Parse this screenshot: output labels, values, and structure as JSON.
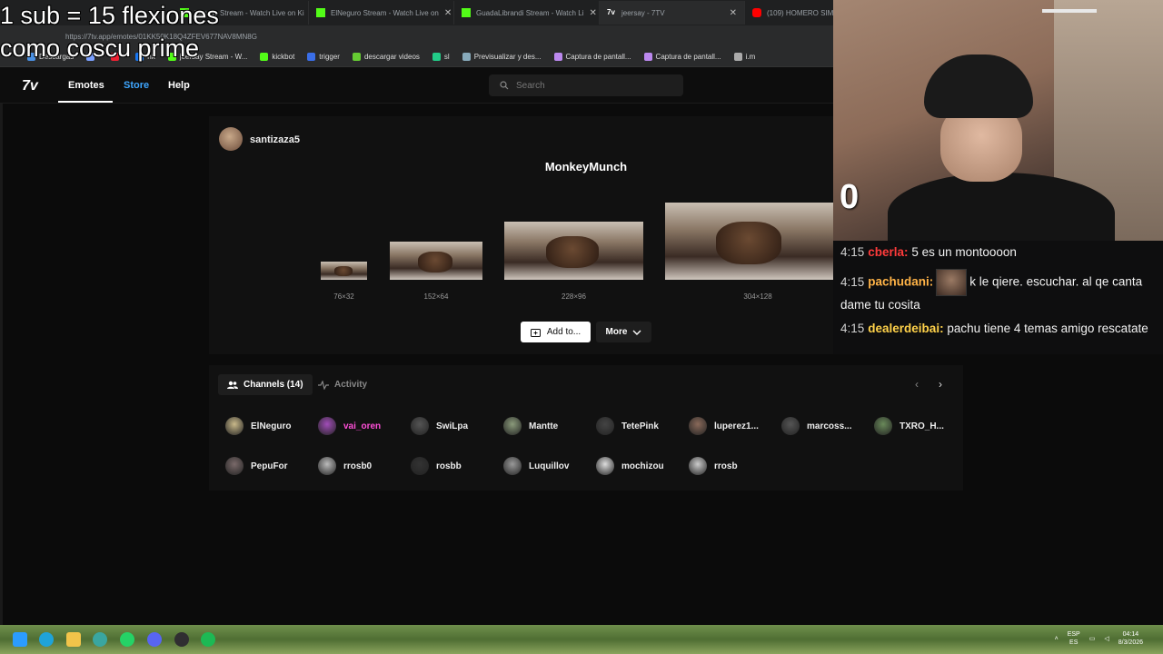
{
  "overlay": {
    "line1": "1 sub = 15 flexiones",
    "line2": "como coscu prime"
  },
  "browser": {
    "tabs": [
      {
        "title": "jeersay Stream - Watch Live on Ki",
        "icon_color": "#53fc18",
        "active": false
      },
      {
        "title": "ElNeguro Stream - Watch Live on",
        "icon_color": "#53fc18",
        "active": false
      },
      {
        "title": "GuadaLibrandi Stream - Watch Li",
        "icon_color": "#53fc18",
        "active": false
      },
      {
        "title": "jeersay - 7TV",
        "icon_color": "#ffffff",
        "active": true
      },
      {
        "title": "(109) HOMERO SIM",
        "icon_color": "#ff0000",
        "active": false
      }
    ],
    "url": "https://7tv.app/emotes/01KK50K18Q4ZFEV677NAV8MN8G",
    "bookmarks": [
      {
        "label": "Descargas",
        "color": "#4a90e2"
      },
      {
        "label": "",
        "color": "#7aa0ff"
      },
      {
        "label": "",
        "color": "#e23"
      },
      {
        "label": "nk",
        "color": "#1877f2"
      },
      {
        "label": "jeersay Stream - W...",
        "color": "#53fc18"
      },
      {
        "label": "kickbot",
        "color": "#53fc18"
      },
      {
        "label": "trigger",
        "color": "#3a6ee8"
      },
      {
        "label": "descargar videos",
        "color": "#6c3"
      },
      {
        "label": "sl",
        "color": "#2c8"
      },
      {
        "label": "Previsualizar y des...",
        "color": "#8ab"
      },
      {
        "label": "Captura de pantall...",
        "color": "#b8e"
      },
      {
        "label": "Captura de pantall...",
        "color": "#b8e"
      },
      {
        "label": "i.m",
        "color": "#aaa"
      }
    ]
  },
  "site": {
    "logo": "7v",
    "nav": {
      "emotes": "Emotes",
      "store": "Store",
      "help": "Help"
    },
    "search_placeholder": "Search"
  },
  "emote": {
    "owner": "santizaza5",
    "name": "MonkeyMunch",
    "sizes": [
      "76×32",
      "152×64",
      "228×96",
      "304×128"
    ],
    "add_label": "Add to...",
    "more_label": "More"
  },
  "channels": {
    "tab_channels": "Channels (14)",
    "tab_activity": "Activity",
    "list": [
      {
        "name": "ElNeguro",
        "color": "#c9b98a",
        "text_color": "#eeeeee"
      },
      {
        "name": "vai_oren",
        "color": "#a14db8",
        "text_color": "#ff4fd8"
      },
      {
        "name": "SwiLpa",
        "color": "#555555",
        "text_color": "#eeeeee"
      },
      {
        "name": "Mantte",
        "color": "#8b9b7b",
        "text_color": "#eeeeee"
      },
      {
        "name": "TetePink",
        "color": "#444444",
        "text_color": "#eeeeee"
      },
      {
        "name": "luperez1...",
        "color": "#8a6a5a",
        "text_color": "#eeeeee"
      },
      {
        "name": "marcoss...",
        "color": "#555555",
        "text_color": "#eeeeee"
      },
      {
        "name": "TXRO_H...",
        "color": "#6a8a5a",
        "text_color": "#eeeeee"
      },
      {
        "name": "PepuFor",
        "color": "#7a6a6a",
        "text_color": "#eeeeee"
      },
      {
        "name": "rrosb0",
        "color": "#bbbbbb",
        "text_color": "#eeeeee"
      },
      {
        "name": "rosbb",
        "color": "#333333",
        "text_color": "#eeeeee"
      },
      {
        "name": "Luquillov",
        "color": "#999999",
        "text_color": "#eeeeee"
      },
      {
        "name": "mochizou",
        "color": "#dddddd",
        "text_color": "#eeeeee"
      },
      {
        "name": "rrosb",
        "color": "#cccccc",
        "text_color": "#eeeeee"
      }
    ]
  },
  "stream": {
    "counter": "0"
  },
  "chat": [
    {
      "time": "4:15",
      "user": "cberla:",
      "user_color": "#ff3b3b",
      "text": "5 es un montoooon",
      "emote": false
    },
    {
      "time": "4:15",
      "user": "pachudani:",
      "user_color": "#ffb347",
      "text": "k le qiere. escuchar. al qe canta dame tu cosita",
      "emote": true
    },
    {
      "time": "4:15",
      "user": "dealerdeibai:",
      "user_color": "#ffd24a",
      "text": "pachu tiene 4 temas amigo rescatate",
      "emote": false
    }
  ],
  "taskbar": {
    "lang_line1": "ESP",
    "lang_line2": "ES",
    "time": "04:14",
    "date": "8/3/2026"
  }
}
